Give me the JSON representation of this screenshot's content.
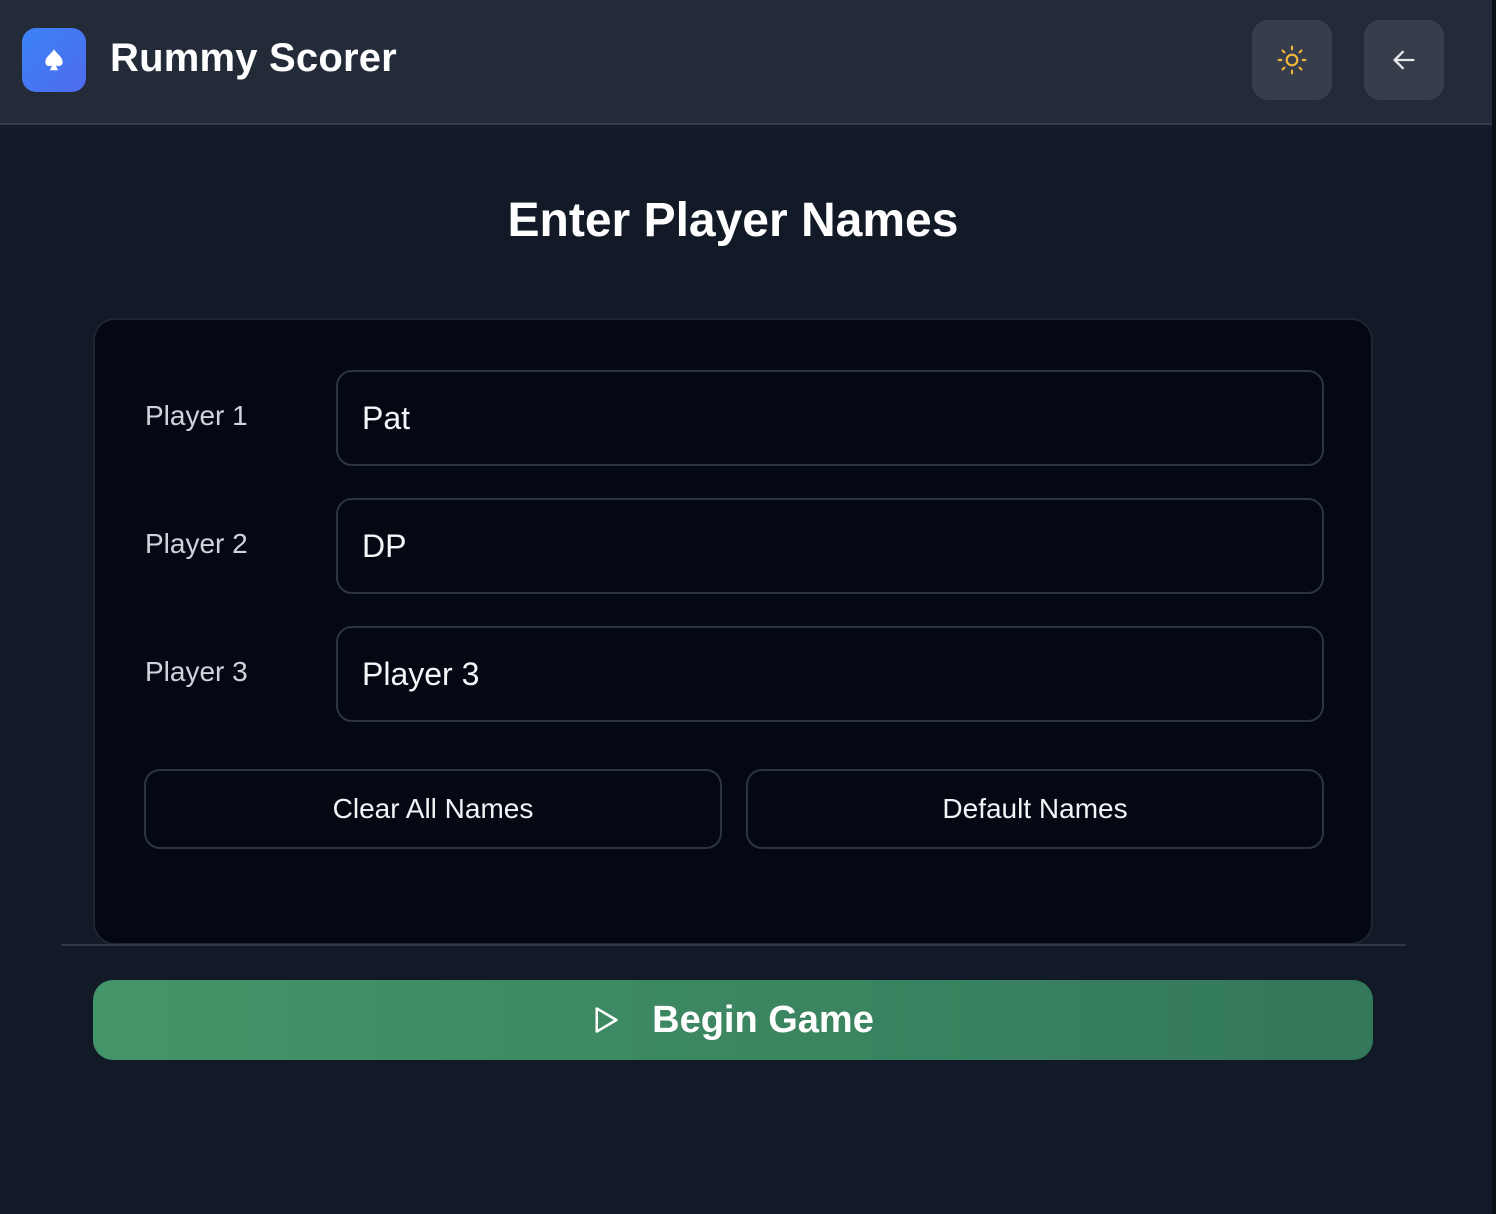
{
  "header": {
    "app_title": "Rummy Scorer",
    "logo_icon": "spade-icon",
    "theme_icon": "sun-icon",
    "back_icon": "arrow-left-icon",
    "logo_color": "#3b82f6",
    "sun_color": "#f0b73c"
  },
  "main": {
    "title": "Enter Player Names",
    "players": [
      {
        "label": "Player 1",
        "value": "Pat"
      },
      {
        "label": "Player 2",
        "value": "DP"
      },
      {
        "label": "Player 3",
        "value": "Player 3"
      }
    ],
    "clear_label": "Clear All Names",
    "default_label": "Default Names",
    "begin_label": "Begin Game",
    "begin_icon": "play-icon",
    "begin_color": "#44956a"
  }
}
